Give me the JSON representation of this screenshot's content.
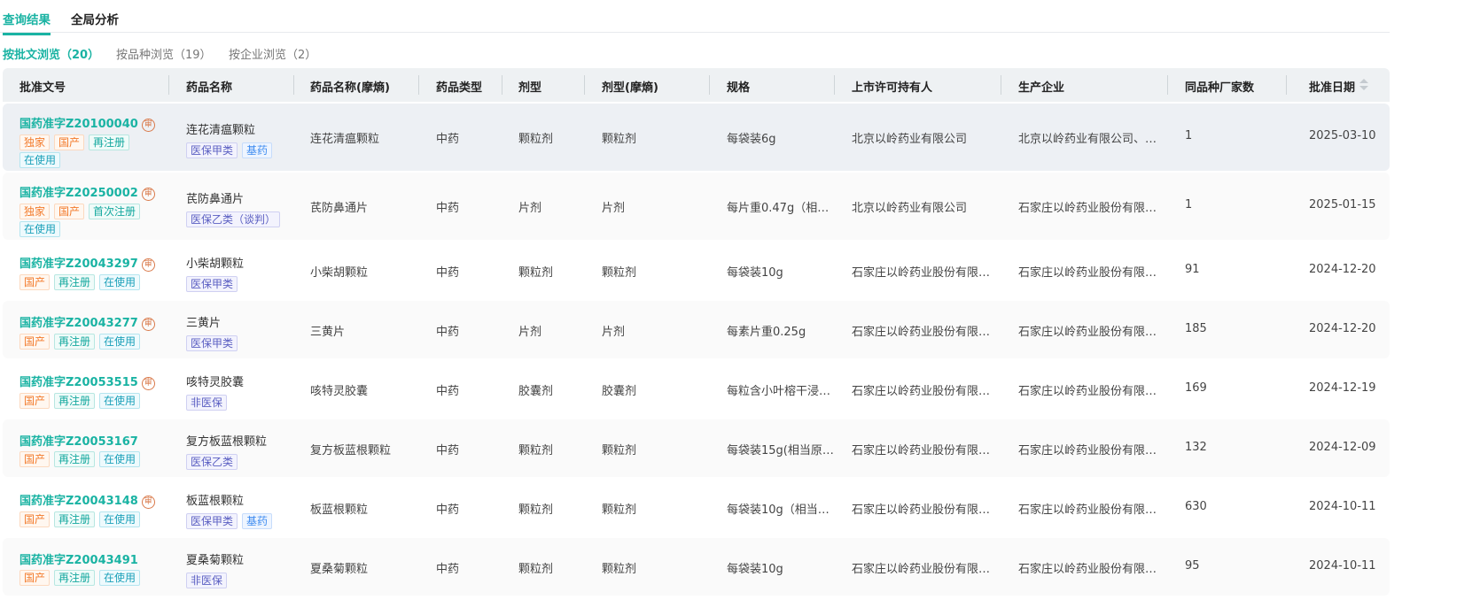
{
  "tabs": [
    "查询结果",
    "全局分析"
  ],
  "subtabs": [
    "按批文浏览（20）",
    "按品种浏览（19）",
    "按企业浏览（2）"
  ],
  "columns": [
    "批准文号",
    "药品名称",
    "药品名称(摩熵)",
    "药品类型",
    "剂型",
    "剂型(摩熵)",
    "规格",
    "上市许可持有人",
    "生产企业",
    "同品种厂家数",
    "批准日期"
  ],
  "review_icon": "审",
  "rows": [
    {
      "code": "国药准字Z20100040",
      "review": true,
      "tags": [
        [
          "独家",
          "or"
        ],
        [
          "国产",
          "or"
        ],
        [
          "再注册",
          "te"
        ],
        [
          "在使用",
          "cy"
        ]
      ],
      "name": "连花清瘟颗粒",
      "name_tags": [
        [
          "医保甲类",
          "pu"
        ],
        [
          "基药",
          "bl"
        ]
      ],
      "name_ms": "连花清瘟颗粒",
      "type": "中药",
      "form": "颗粒剂",
      "form_ms": "颗粒剂",
      "spec": "每袋装6g",
      "holder": "北京以岭药业有限公司",
      "maker": "北京以岭药业有限公司、…",
      "count": "1",
      "date": "2025-03-10"
    },
    {
      "code": "国药准字Z20250002",
      "review": true,
      "tags": [
        [
          "独家",
          "or"
        ],
        [
          "国产",
          "or"
        ],
        [
          "首次注册",
          "te"
        ],
        [
          "在使用",
          "cy"
        ]
      ],
      "name": "芪防鼻通片",
      "name_tags": [
        [
          "医保乙类（谈判）",
          "pu"
        ]
      ],
      "name_ms": "芪防鼻通片",
      "type": "中药",
      "form": "片剂",
      "form_ms": "片剂",
      "spec": "每片重0.47g（相…",
      "holder": "北京以岭药业有限公司",
      "maker": "石家庄以岭药业股份有限…",
      "count": "1",
      "date": "2025-01-15"
    },
    {
      "code": "国药准字Z20043297",
      "review": true,
      "tags": [
        [
          "国产",
          "or"
        ],
        [
          "再注册",
          "te"
        ],
        [
          "在使用",
          "cy"
        ]
      ],
      "name": "小柴胡颗粒",
      "name_tags": [
        [
          "医保甲类",
          "pu"
        ]
      ],
      "name_ms": "小柴胡颗粒",
      "type": "中药",
      "form": "颗粒剂",
      "form_ms": "颗粒剂",
      "spec": "每袋装10g",
      "holder": "石家庄以岭药业股份有限…",
      "maker": "石家庄以岭药业股份有限…",
      "count": "91",
      "date": "2024-12-20"
    },
    {
      "code": "国药准字Z20043277",
      "review": true,
      "tags": [
        [
          "国产",
          "or"
        ],
        [
          "再注册",
          "te"
        ],
        [
          "在使用",
          "cy"
        ]
      ],
      "name": "三黄片",
      "name_tags": [
        [
          "医保甲类",
          "pu"
        ]
      ],
      "name_ms": "三黄片",
      "type": "中药",
      "form": "片剂",
      "form_ms": "片剂",
      "spec": "每素片重0.25g",
      "holder": "石家庄以岭药业股份有限…",
      "maker": "石家庄以岭药业股份有限…",
      "count": "185",
      "date": "2024-12-20"
    },
    {
      "code": "国药准字Z20053515",
      "review": true,
      "tags": [
        [
          "国产",
          "or"
        ],
        [
          "再注册",
          "te"
        ],
        [
          "在使用",
          "cy"
        ]
      ],
      "name": "咳特灵胶囊",
      "name_tags": [
        [
          "非医保",
          "pu"
        ]
      ],
      "name_ms": "咳特灵胶囊",
      "type": "中药",
      "form": "胶囊剂",
      "form_ms": "胶囊剂",
      "spec": "每粒含小叶榕干浸…",
      "holder": "石家庄以岭药业股份有限…",
      "maker": "石家庄以岭药业股份有限…",
      "count": "169",
      "date": "2024-12-19"
    },
    {
      "code": "国药准字Z20053167",
      "review": false,
      "tags": [
        [
          "国产",
          "or"
        ],
        [
          "再注册",
          "te"
        ],
        [
          "在使用",
          "cy"
        ]
      ],
      "name": "复方板蓝根颗粒",
      "name_tags": [
        [
          "医保乙类",
          "pu"
        ]
      ],
      "name_ms": "复方板蓝根颗粒",
      "type": "中药",
      "form": "颗粒剂",
      "form_ms": "颗粒剂",
      "spec": "每袋装15g(相当原…",
      "holder": "石家庄以岭药业股份有限…",
      "maker": "石家庄以岭药业股份有限…",
      "count": "132",
      "date": "2024-12-09"
    },
    {
      "code": "国药准字Z20043148",
      "review": true,
      "tags": [
        [
          "国产",
          "or"
        ],
        [
          "再注册",
          "te"
        ],
        [
          "在使用",
          "cy"
        ]
      ],
      "name": "板蓝根颗粒",
      "name_tags": [
        [
          "医保甲类",
          "pu"
        ],
        [
          "基药",
          "bl"
        ]
      ],
      "name_ms": "板蓝根颗粒",
      "type": "中药",
      "form": "颗粒剂",
      "form_ms": "颗粒剂",
      "spec": "每袋装10g（相当…",
      "holder": "石家庄以岭药业股份有限…",
      "maker": "石家庄以岭药业股份有限…",
      "count": "630",
      "date": "2024-10-11"
    },
    {
      "code": "国药准字Z20043491",
      "review": false,
      "tags": [
        [
          "国产",
          "or"
        ],
        [
          "再注册",
          "te"
        ],
        [
          "在使用",
          "cy"
        ]
      ],
      "name": "夏桑菊颗粒",
      "name_tags": [
        [
          "非医保",
          "pu"
        ]
      ],
      "name_ms": "夏桑菊颗粒",
      "type": "中药",
      "form": "颗粒剂",
      "form_ms": "颗粒剂",
      "spec": "每袋装10g",
      "holder": "石家庄以岭药业股份有限…",
      "maker": "石家庄以岭药业股份有限…",
      "count": "95",
      "date": "2024-10-11"
    }
  ]
}
